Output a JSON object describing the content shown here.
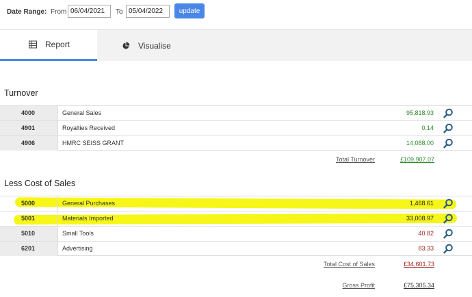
{
  "filter": {
    "date_range_label": "Date Range:",
    "from_label": "From",
    "from_value": "06/04/2021",
    "to_label": "To",
    "to_value": "05/04/2022",
    "update_label": "update",
    "accent": "#4a86e8"
  },
  "tabs": [
    {
      "label": "Report",
      "icon": "table-icon",
      "active": true
    },
    {
      "label": "Visualise",
      "icon": "pie-chart-icon",
      "active": false
    }
  ],
  "turnover": {
    "title": "Turnover",
    "rows": [
      {
        "code": "4000",
        "name": "General Sales",
        "amount": "95,818.93"
      },
      {
        "code": "4901",
        "name": "Royalties Received",
        "amount": "0.14"
      },
      {
        "code": "4906",
        "name": "HMRC SEISS GRANT",
        "amount": "14,088.00"
      }
    ],
    "total_label": "Total Turnover",
    "total_value": "£109,907.07",
    "color": "#2e8b2e"
  },
  "cost_of_sales": {
    "title": "Less Cost of Sales",
    "rows": [
      {
        "code": "5000",
        "name": "General Purchases",
        "amount": "1,468.61",
        "highlighted": true
      },
      {
        "code": "5001",
        "name": "Materials Imported",
        "amount": "33,008.97",
        "highlighted": true
      },
      {
        "code": "5010",
        "name": "Small Tools",
        "amount": "40.82",
        "highlighted": false
      },
      {
        "code": "6201",
        "name": "Advertising",
        "amount": "83.33",
        "highlighted": false
      }
    ],
    "total_label": "Total Cost of Sales",
    "total_value": "£34,601.73",
    "color": "#a02020"
  },
  "gross_profit": {
    "label": "Gross Profit",
    "value": "£75,305.34"
  },
  "highlight_color": "#f5f500",
  "zoom_icon_color": "#2a5d8a"
}
